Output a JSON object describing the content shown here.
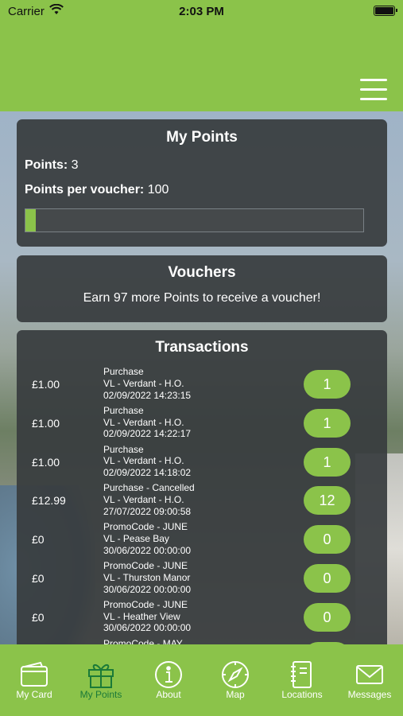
{
  "status_bar": {
    "carrier": "Carrier",
    "time": "2:03 PM"
  },
  "points_card": {
    "title": "My Points",
    "points_label": "Points:",
    "points_value": "3",
    "per_voucher_label": "Points per voucher:",
    "per_voucher_value": "100",
    "progress_fraction": 0.03
  },
  "vouchers_card": {
    "title": "Vouchers",
    "message": "Earn 97 more Points to receive a voucher!"
  },
  "transactions_card": {
    "title": "Transactions",
    "rows": [
      {
        "amount": "£1.00",
        "type": "Purchase",
        "location": "VL - Verdant - H.O.",
        "datetime": "02/09/2022 14:23:15",
        "points": "1"
      },
      {
        "amount": "£1.00",
        "type": "Purchase",
        "location": "VL - Verdant - H.O.",
        "datetime": "02/09/2022 14:22:17",
        "points": "1"
      },
      {
        "amount": "£1.00",
        "type": "Purchase",
        "location": "VL - Verdant - H.O.",
        "datetime": "02/09/2022 14:18:02",
        "points": "1"
      },
      {
        "amount": "£12.99",
        "type": "Purchase - Cancelled",
        "location": "VL - Verdant - H.O.",
        "datetime": "27/07/2022 09:00:58",
        "points": "12"
      },
      {
        "amount": "£0",
        "type": "PromoCode - JUNE",
        "location": "VL - Pease Bay",
        "datetime": "30/06/2022 00:00:00",
        "points": "0"
      },
      {
        "amount": "£0",
        "type": "PromoCode - JUNE",
        "location": "VL - Thurston Manor",
        "datetime": "30/06/2022 00:00:00",
        "points": "0"
      },
      {
        "amount": "£0",
        "type": "PromoCode - JUNE",
        "location": "VL - Heather View",
        "datetime": "30/06/2022 00:00:00",
        "points": "0"
      },
      {
        "amount": "",
        "type": "PromoCode - MAY",
        "location": "",
        "datetime": "",
        "points": ""
      }
    ]
  },
  "tabs": [
    {
      "label": "My Card",
      "icon": "wallet-icon",
      "active": false
    },
    {
      "label": "My Points",
      "icon": "gift-icon",
      "active": true
    },
    {
      "label": "About",
      "icon": "info-icon",
      "active": false
    },
    {
      "label": "Map",
      "icon": "compass-icon",
      "active": false
    },
    {
      "label": "Locations",
      "icon": "notebook-icon",
      "active": false
    },
    {
      "label": "Messages",
      "icon": "envelope-icon",
      "active": false
    }
  ],
  "colors": {
    "brand_green": "#8bc34a",
    "active_tab": "#1b7a38",
    "card_bg": "#383c3e"
  }
}
